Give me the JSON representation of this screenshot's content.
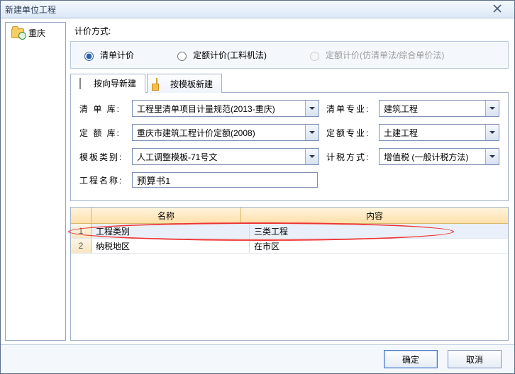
{
  "window": {
    "title": "新建单位工程"
  },
  "sidebar": {
    "root": "重庆"
  },
  "pricing": {
    "label": "计价方式:",
    "options": [
      {
        "label": "清单计价",
        "checked": true,
        "enabled": true
      },
      {
        "label": "定额计价(工料机法)",
        "checked": false,
        "enabled": true
      },
      {
        "label": "定额计价(仿清单法/综合单价法)",
        "checked": false,
        "enabled": false
      }
    ]
  },
  "tabs": [
    {
      "label": "按向导新建",
      "active": true
    },
    {
      "label": "按模板新建",
      "active": false
    }
  ],
  "form": {
    "list_lib": {
      "label": "清 单 库:",
      "value": "工程里清单项目计量规范(2013-重庆)"
    },
    "list_spec": {
      "label": "清单专业:",
      "value": "建筑工程"
    },
    "norm_lib": {
      "label": "定 额 库:",
      "value": "重庆市建筑工程计价定额(2008)"
    },
    "norm_spec": {
      "label": "定额专业:",
      "value": "土建工程"
    },
    "tpl_cat": {
      "label": "模板类别:",
      "value": "人工调整模板-71号文"
    },
    "tax_method": {
      "label": "计税方式:",
      "value": "增值税 (一般计税方法)"
    },
    "proj_name": {
      "label": "工程名称:",
      "value": "预算书1"
    }
  },
  "grid": {
    "headers": {
      "name": "名称",
      "content": "内容"
    },
    "rows": [
      {
        "idx": "1",
        "name": "工程类别",
        "content": "三类工程",
        "selected": true
      },
      {
        "idx": "2",
        "name": "纳税地区",
        "content": "在市区",
        "selected": false
      }
    ]
  },
  "footer": {
    "ok": "确定",
    "cancel": "取消"
  }
}
